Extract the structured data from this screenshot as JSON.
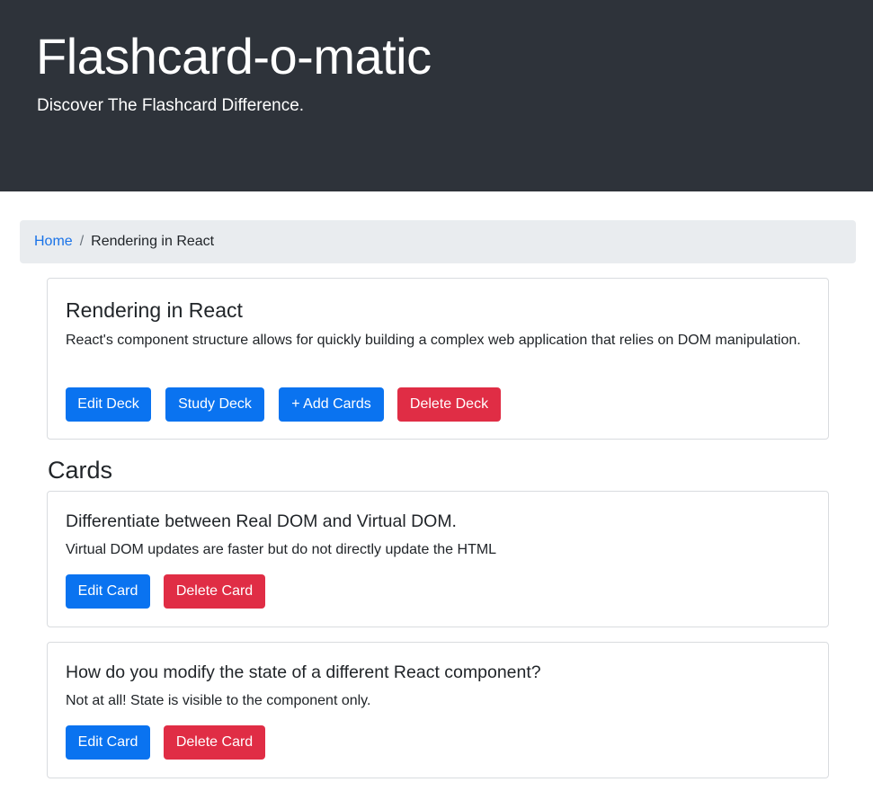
{
  "header": {
    "title": "Flashcard-o-matic",
    "tagline": "Discover The Flashcard Difference."
  },
  "breadcrumb": {
    "home": "Home",
    "separator": "/",
    "current": "Rendering in React"
  },
  "deck": {
    "name": "Rendering in React",
    "description": "React's component structure allows for quickly building a complex web application that relies on DOM manipulation.",
    "edit_label": "Edit Deck",
    "study_label": "Study Deck",
    "add_cards_label": "+ Add Cards",
    "delete_label": "Delete Deck"
  },
  "cards_heading": "Cards",
  "cards": [
    {
      "front": "Differentiate between Real DOM and Virtual DOM.",
      "back": "Virtual DOM updates are faster but do not directly update the HTML",
      "edit_label": "Edit Card",
      "delete_label": "Delete Card"
    },
    {
      "front": "How do you modify the state of a different React component?",
      "back": "Not at all! State is visible to the component only.",
      "edit_label": "Edit Card",
      "delete_label": "Delete Card"
    }
  ],
  "colors": {
    "header_bg": "#2e333a",
    "primary": "#0a73f0",
    "danger": "#e02d45",
    "breadcrumb_bg": "#e9ecef",
    "link": "#1a73e8"
  }
}
